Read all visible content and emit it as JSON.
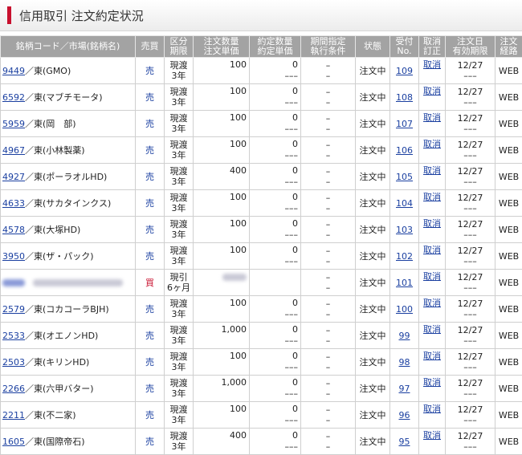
{
  "title": "信用取引 注文約定状況",
  "headers": {
    "code": "銘柄コード／市場(銘柄名)",
    "side": "売買",
    "kubun": [
      "区分",
      "期限"
    ],
    "order": [
      "注文数量",
      "注文単価"
    ],
    "exec": [
      "約定数量",
      "約定単価"
    ],
    "cond": [
      "期間指定",
      "執行条件"
    ],
    "status": "状態",
    "recv": [
      "受付",
      "No."
    ],
    "cancel": [
      "取消",
      "訂正"
    ],
    "date": [
      "注文日",
      "有効期限"
    ],
    "route": [
      "注文",
      "経路"
    ]
  },
  "rows": [
    {
      "code": "9449",
      "name": "東(GMO)",
      "side": "売",
      "side_type": "sell",
      "kubun1": "現渡",
      "kubun2": "3年",
      "qty": "100",
      "price": "",
      "exec_qty": "0",
      "exec_price": "–––",
      "cond1": "–",
      "cond2": "–",
      "status": "注文中",
      "recv": "109",
      "cancel": "取消",
      "date1": "12/27",
      "date2": "–––",
      "route": "WEB"
    },
    {
      "code": "6592",
      "name": "東(マブチモータ)",
      "side": "売",
      "side_type": "sell",
      "kubun1": "現渡",
      "kubun2": "3年",
      "qty": "100",
      "price": "",
      "exec_qty": "0",
      "exec_price": "–––",
      "cond1": "–",
      "cond2": "–",
      "status": "注文中",
      "recv": "108",
      "cancel": "取消",
      "date1": "12/27",
      "date2": "–––",
      "route": "WEB"
    },
    {
      "code": "5959",
      "name": "東(岡　部)",
      "side": "売",
      "side_type": "sell",
      "kubun1": "現渡",
      "kubun2": "3年",
      "qty": "100",
      "price": "",
      "exec_qty": "0",
      "exec_price": "–––",
      "cond1": "–",
      "cond2": "–",
      "status": "注文中",
      "recv": "107",
      "cancel": "取消",
      "date1": "12/27",
      "date2": "–––",
      "route": "WEB"
    },
    {
      "code": "4967",
      "name": "東(小林製薬)",
      "side": "売",
      "side_type": "sell",
      "kubun1": "現渡",
      "kubun2": "3年",
      "qty": "100",
      "price": "",
      "exec_qty": "0",
      "exec_price": "–––",
      "cond1": "–",
      "cond2": "–",
      "status": "注文中",
      "recv": "106",
      "cancel": "取消",
      "date1": "12/27",
      "date2": "–––",
      "route": "WEB"
    },
    {
      "code": "4927",
      "name": "東(ポーラオルHD)",
      "side": "売",
      "side_type": "sell",
      "kubun1": "現渡",
      "kubun2": "3年",
      "qty": "400",
      "price": "",
      "exec_qty": "0",
      "exec_price": "–––",
      "cond1": "–",
      "cond2": "–",
      "status": "注文中",
      "recv": "105",
      "cancel": "取消",
      "date1": "12/27",
      "date2": "–––",
      "route": "WEB"
    },
    {
      "code": "4633",
      "name": "東(サカタインクス)",
      "side": "売",
      "side_type": "sell",
      "kubun1": "現渡",
      "kubun2": "3年",
      "qty": "100",
      "price": "",
      "exec_qty": "0",
      "exec_price": "–––",
      "cond1": "–",
      "cond2": "–",
      "status": "注文中",
      "recv": "104",
      "cancel": "取消",
      "date1": "12/27",
      "date2": "–––",
      "route": "WEB"
    },
    {
      "code": "4578",
      "name": "東(大塚HD)",
      "side": "売",
      "side_type": "sell",
      "kubun1": "現渡",
      "kubun2": "3年",
      "qty": "100",
      "price": "",
      "exec_qty": "0",
      "exec_price": "–––",
      "cond1": "–",
      "cond2": "–",
      "status": "注文中",
      "recv": "103",
      "cancel": "取消",
      "date1": "12/27",
      "date2": "–––",
      "route": "WEB"
    },
    {
      "code": "3950",
      "name": "東(ザ・パック)",
      "side": "売",
      "side_type": "sell",
      "kubun1": "現渡",
      "kubun2": "3年",
      "qty": "100",
      "price": "",
      "exec_qty": "0",
      "exec_price": "–––",
      "cond1": "–",
      "cond2": "–",
      "status": "注文中",
      "recv": "102",
      "cancel": "取消",
      "date1": "12/27",
      "date2": "–––",
      "route": "WEB"
    },
    {
      "code": "",
      "name": "",
      "blurred": true,
      "side": "買",
      "side_type": "buy",
      "kubun1": "現引",
      "kubun2": "6ヶ月",
      "qty": "",
      "price": "",
      "exec_qty": "",
      "exec_price": "",
      "cond1": "–",
      "cond2": "–",
      "status": "注文中",
      "recv": "101",
      "cancel": "取消",
      "date1": "12/27",
      "date2": "–––",
      "route": "WEB"
    },
    {
      "code": "2579",
      "name": "東(コカコーラBJH)",
      "side": "売",
      "side_type": "sell",
      "kubun1": "現渡",
      "kubun2": "3年",
      "qty": "100",
      "price": "",
      "exec_qty": "0",
      "exec_price": "–––",
      "cond1": "–",
      "cond2": "–",
      "status": "注文中",
      "recv": "100",
      "cancel": "取消",
      "date1": "12/27",
      "date2": "–––",
      "route": "WEB"
    },
    {
      "code": "2533",
      "name": "東(オエノンHD)",
      "side": "売",
      "side_type": "sell",
      "kubun1": "現渡",
      "kubun2": "3年",
      "qty": "1,000",
      "price": "",
      "exec_qty": "0",
      "exec_price": "–––",
      "cond1": "–",
      "cond2": "–",
      "status": "注文中",
      "recv": "99",
      "cancel": "取消",
      "date1": "12/27",
      "date2": "–––",
      "route": "WEB"
    },
    {
      "code": "2503",
      "name": "東(キリンHD)",
      "side": "売",
      "side_type": "sell",
      "kubun1": "現渡",
      "kubun2": "3年",
      "qty": "100",
      "price": "",
      "exec_qty": "0",
      "exec_price": "–––",
      "cond1": "–",
      "cond2": "–",
      "status": "注文中",
      "recv": "98",
      "cancel": "取消",
      "date1": "12/27",
      "date2": "–––",
      "route": "WEB"
    },
    {
      "code": "2266",
      "name": "東(六甲バター)",
      "side": "売",
      "side_type": "sell",
      "kubun1": "現渡",
      "kubun2": "3年",
      "qty": "1,000",
      "price": "",
      "exec_qty": "0",
      "exec_price": "–––",
      "cond1": "–",
      "cond2": "–",
      "status": "注文中",
      "recv": "97",
      "cancel": "取消",
      "date1": "12/27",
      "date2": "–––",
      "route": "WEB"
    },
    {
      "code": "2211",
      "name": "東(不二家)",
      "side": "売",
      "side_type": "sell",
      "kubun1": "現渡",
      "kubun2": "3年",
      "qty": "100",
      "price": "",
      "exec_qty": "0",
      "exec_price": "–––",
      "cond1": "–",
      "cond2": "–",
      "status": "注文中",
      "recv": "96",
      "cancel": "取消",
      "date1": "12/27",
      "date2": "–––",
      "route": "WEB"
    },
    {
      "code": "1605",
      "name": "東(国際帝石)",
      "side": "売",
      "side_type": "sell",
      "kubun1": "現渡",
      "kubun2": "3年",
      "qty": "400",
      "price": "",
      "exec_qty": "0",
      "exec_price": "–––",
      "cond1": "–",
      "cond2": "–",
      "status": "注文中",
      "recv": "95",
      "cancel": "取消",
      "date1": "12/27",
      "date2": "–––",
      "route": "WEB"
    }
  ],
  "colors": {
    "accent": "#c8102e",
    "header_bg": "#a3a3a3",
    "link": "#1a3fa0",
    "sell": "#1a3fa0",
    "buy": "#c8102e"
  }
}
